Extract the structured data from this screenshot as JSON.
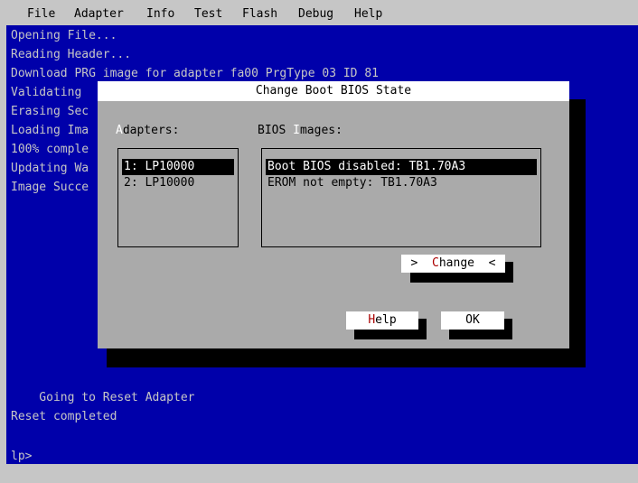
{
  "menubar": {
    "items": [
      "File",
      "Adapter",
      "Info",
      "Test",
      "Flash",
      "Debug",
      "Help"
    ]
  },
  "terminal": {
    "lines": [
      "Opening File...",
      "Reading Header...",
      "Download PRG image for adapter fa00 PrgType 03 ID 81",
      "Validating",
      "Erasing Sec",
      "Loading Ima",
      "100% comple",
      "Updating Wa",
      "Image Succe"
    ],
    "reset_line": "    Going to Reset Adapter",
    "reset_done": "Reset completed",
    "prompt": "lp>"
  },
  "dialog": {
    "title": "Change Boot BIOS State",
    "adapters_label_hotkey": "A",
    "adapters_label_rest": "dapters:",
    "adapters": [
      "1: LP10000",
      "2: LP10000"
    ],
    "bios_label_pre": "BIOS ",
    "bios_label_hotkey": "I",
    "bios_label_rest": "mages:",
    "bios_images": [
      "Boot BIOS disabled: TB1.70A3",
      "EROM not empty: TB1.70A3"
    ],
    "change_button": {
      "left": ">  ",
      "hotkey": "C",
      "rest": "hange  <"
    },
    "help_button": {
      "hotkey": "H",
      "rest": "elp"
    },
    "ok_button": "OK"
  }
}
